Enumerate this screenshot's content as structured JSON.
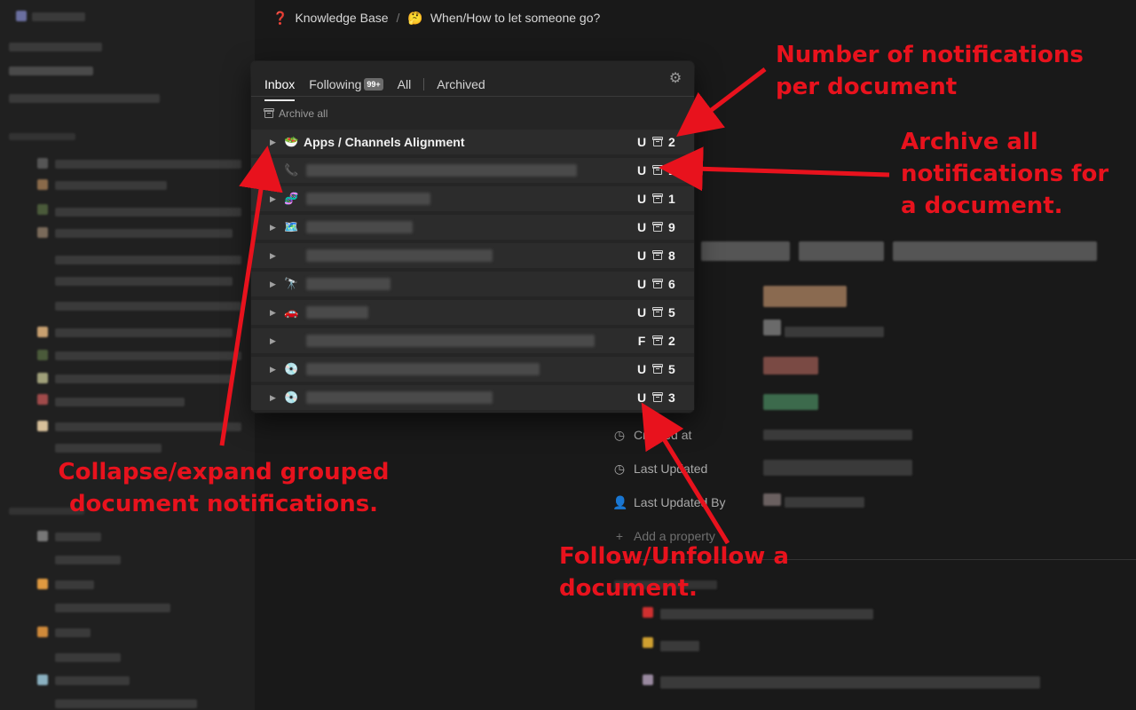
{
  "breadcrumb": {
    "items": [
      {
        "icon": "question-mark-icon",
        "glyph": "❓",
        "label": "Knowledge Base"
      },
      {
        "icon": "thinking-face-icon",
        "glyph": "🤔",
        "label": "When/How to let someone go?"
      }
    ],
    "separator": "/"
  },
  "inbox": {
    "tabs": [
      {
        "label": "Inbox",
        "active": true
      },
      {
        "label": "Following",
        "badge": "99+"
      },
      {
        "label": "All"
      },
      {
        "label": "Archived"
      }
    ],
    "archive_all_label": "Archive all",
    "rows": [
      {
        "icon_glyph": "🥗",
        "title": "Apps / Channels Alignment",
        "follow": "U",
        "count": "2"
      },
      {
        "icon_glyph": "📞",
        "title": "",
        "follow": "U",
        "count": "1"
      },
      {
        "icon_glyph": "🧬",
        "title": "",
        "follow": "U",
        "count": "1"
      },
      {
        "icon_glyph": "🗺️",
        "title": "",
        "follow": "U",
        "count": "9"
      },
      {
        "icon_glyph": "",
        "title": "",
        "follow": "U",
        "count": "8"
      },
      {
        "icon_glyph": "🔭",
        "title": "",
        "follow": "U",
        "count": "6"
      },
      {
        "icon_glyph": "🚗",
        "title": "",
        "follow": "U",
        "count": "5"
      },
      {
        "icon_glyph": "",
        "title": "",
        "follow": "F",
        "count": "2"
      },
      {
        "icon_glyph": "💿",
        "title": "",
        "follow": "U",
        "count": "5"
      },
      {
        "icon_glyph": "💿",
        "title": "",
        "follow": "U",
        "count": "3"
      }
    ]
  },
  "properties": [
    {
      "icon": "clock-icon",
      "label": "Created at"
    },
    {
      "icon": "clock-icon",
      "label": "Last Updated"
    },
    {
      "icon": "person-icon",
      "label": "Last Updated By"
    },
    {
      "icon": "plus-icon",
      "label": "Add a property"
    }
  ],
  "annotations": {
    "count_note": "Number of notifications per document",
    "archive_note": "Archive all notifications for a document.",
    "collapse_note": "Collapse/expand grouped document notifications.",
    "follow_note": "Follow/Unfollow a document."
  },
  "colors": {
    "annotation": "#e8121d",
    "background": "#191919",
    "sidebar": "#202020",
    "popup": "#252525"
  }
}
